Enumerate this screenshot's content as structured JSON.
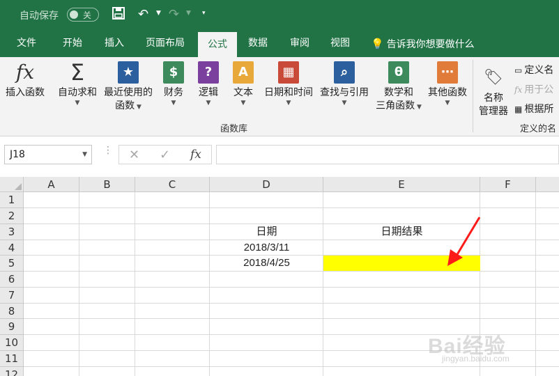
{
  "quick_access": {
    "autosave_label": "自动保存",
    "autosave_state": "关"
  },
  "tabs": [
    {
      "label": "文件"
    },
    {
      "label": "开始"
    },
    {
      "label": "插入"
    },
    {
      "label": "页面布局"
    },
    {
      "label": "公式"
    },
    {
      "label": "数据"
    },
    {
      "label": "审阅"
    },
    {
      "label": "视图"
    }
  ],
  "active_tab": "公式",
  "tell_me": "告诉我你想要做什么",
  "ribbon": {
    "function_library": {
      "buttons": [
        {
          "label": "插入函数",
          "icon": "fx-icon"
        },
        {
          "label": "自动求和",
          "icon": "sigma-icon"
        },
        {
          "label_line1": "最近使用的",
          "label_line2": "函数",
          "icon": "star-book-icon"
        },
        {
          "label": "财务",
          "icon": "finance-book-icon"
        },
        {
          "label": "逻辑",
          "icon": "logic-book-icon"
        },
        {
          "label": "文本",
          "icon": "text-book-icon"
        },
        {
          "label": "日期和时间",
          "icon": "calendar-book-icon"
        },
        {
          "label": "查找与引用",
          "icon": "lookup-book-icon"
        },
        {
          "label_line1": "数学和",
          "label_line2": "三角函数",
          "icon": "theta-book-icon"
        },
        {
          "label": "其他函数",
          "icon": "more-book-icon"
        }
      ],
      "group_label": "函数库"
    },
    "defined_names": {
      "name_manager_line1": "名称",
      "name_manager_line2": "管理器",
      "define_name": "定义名",
      "use_in_formula": "用于公",
      "create_from_selection": "根据所",
      "group_label": "定义的名"
    }
  },
  "formula_bar": {
    "name_box": "J18",
    "fx_label": "fx",
    "formula": ""
  },
  "grid": {
    "columns": [
      "A",
      "B",
      "C",
      "D",
      "E",
      "F"
    ],
    "rows": [
      "1",
      "2",
      "3",
      "4",
      "5",
      "6",
      "7",
      "8",
      "9",
      "10",
      "11",
      "12"
    ],
    "cells": {
      "D3": "日期",
      "E3": "日期结果",
      "D4": "2018/3/11",
      "D5": "2018/4/25"
    },
    "highlight_cell": "E5",
    "highlight_color": "#ffff00"
  },
  "colors": {
    "excel_green": "#217346",
    "ribbon_bg": "#f3f3f3",
    "annotation_arrow": "#ff1a1a"
  },
  "watermark": {
    "logo": "Bai经验",
    "url": "jingyan.baidu.com"
  }
}
